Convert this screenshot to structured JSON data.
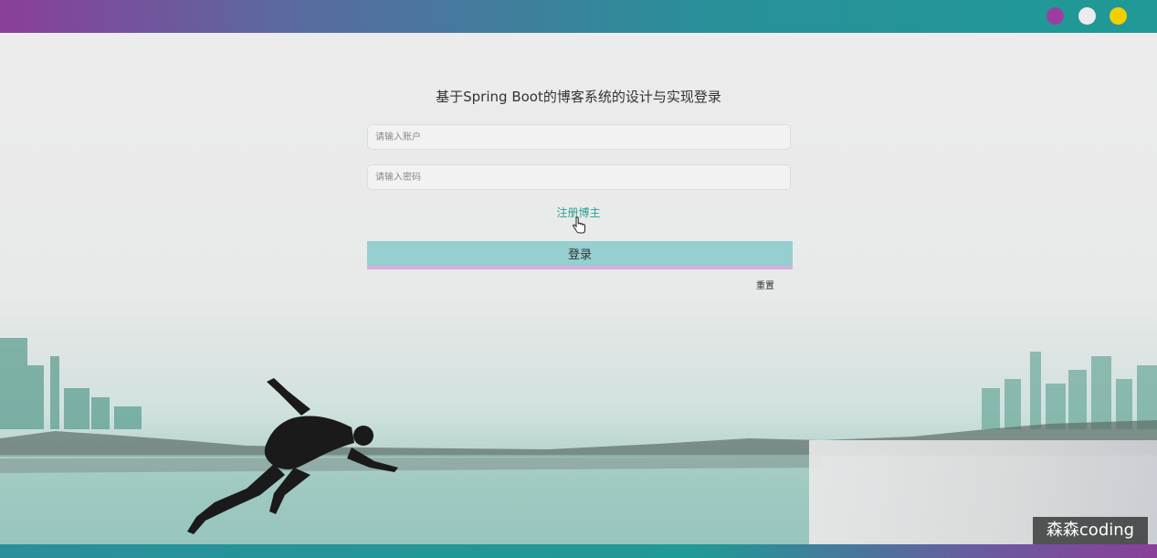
{
  "window": {
    "dots": [
      {
        "name": "purple",
        "color": "#9a3fa0"
      },
      {
        "name": "white",
        "color": "#ecebef"
      },
      {
        "name": "yellow",
        "color": "#f2d000"
      }
    ]
  },
  "login": {
    "title": "基于Spring Boot的博客系统的设计与实现登录",
    "account_placeholder": "请输入账户",
    "password_placeholder": "请输入密码",
    "register_link": "注册博主",
    "submit_label": "登录",
    "reset_label": "重置"
  },
  "watermark": "森森coding",
  "colors": {
    "accent": "#2aa098",
    "login_button": "#95cfcf"
  }
}
